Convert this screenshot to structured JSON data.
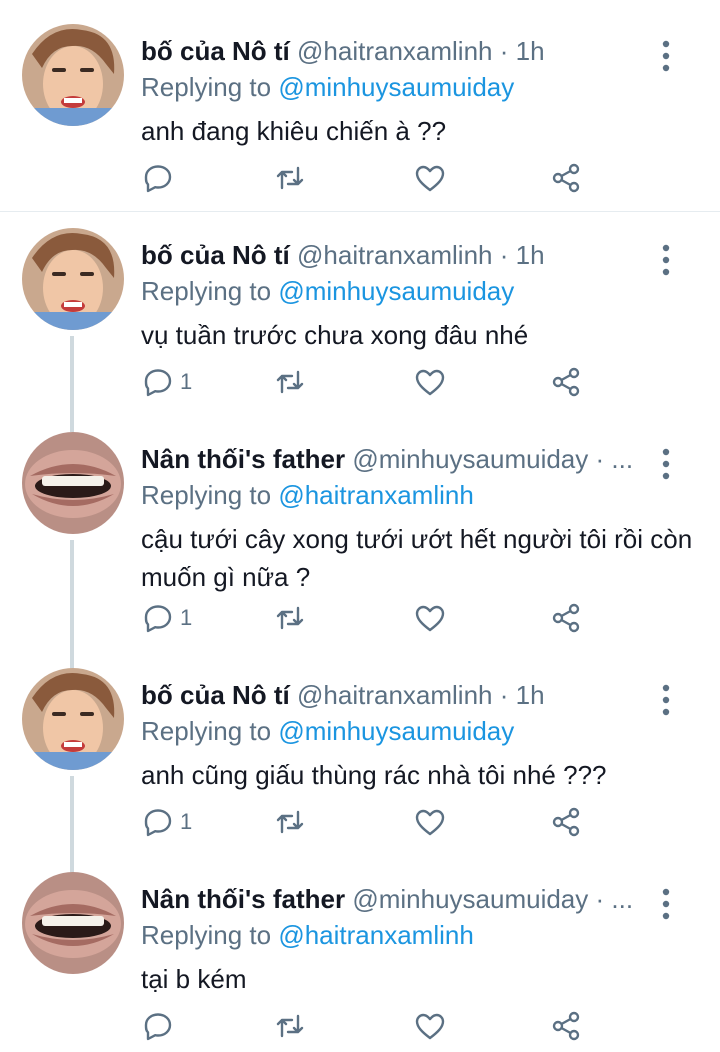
{
  "colors": {
    "link": "#1b95e0",
    "muted": "#5b7083",
    "text": "#141823",
    "line": "#cfd9de"
  },
  "icons": {
    "reply": "reply-icon",
    "retweet": "retweet-icon",
    "like": "heart-icon",
    "share": "share-icon",
    "more": "more-vertical-icon"
  },
  "tweets": [
    {
      "name": "bố của Nô tí",
      "handle": "@haitranxamlinh · 1h",
      "reply_label": "Replying to",
      "reply_to": "@minhuysaumuiday",
      "text": "anh đang khiêu chiến à ??",
      "reply_count": "",
      "avatar": "person-a"
    },
    {
      "name": "bố của Nô tí",
      "handle": "@haitranxamlinh · 1h",
      "reply_label": "Replying to",
      "reply_to": "@minhuysaumuiday",
      "text": "vụ tuần trước chưa xong đâu nhé",
      "reply_count": "1",
      "avatar": "person-a"
    },
    {
      "name": "Nân thối's father",
      "handle": "@minhuysaumuiday · ...",
      "reply_label": "Replying to",
      "reply_to": "@haitranxamlinh",
      "text": "cậu tưới cây xong tưới ướt hết người tôi rồi còn muốn gì nữa ?",
      "reply_count": "1",
      "avatar": "person-b"
    },
    {
      "name": "bố của Nô tí",
      "handle": "@haitranxamlinh · 1h",
      "reply_label": "Replying to",
      "reply_to": "@minhuysaumuiday",
      "text": "anh cũng giấu thùng rác nhà tôi nhé ???",
      "reply_count": "1",
      "avatar": "person-a"
    },
    {
      "name": "Nân thối's father",
      "handle": "@minhuysaumuiday · ...",
      "reply_label": "Replying to",
      "reply_to": "@haitranxamlinh",
      "text": "tại b kém",
      "reply_count": "",
      "avatar": "person-b"
    }
  ]
}
